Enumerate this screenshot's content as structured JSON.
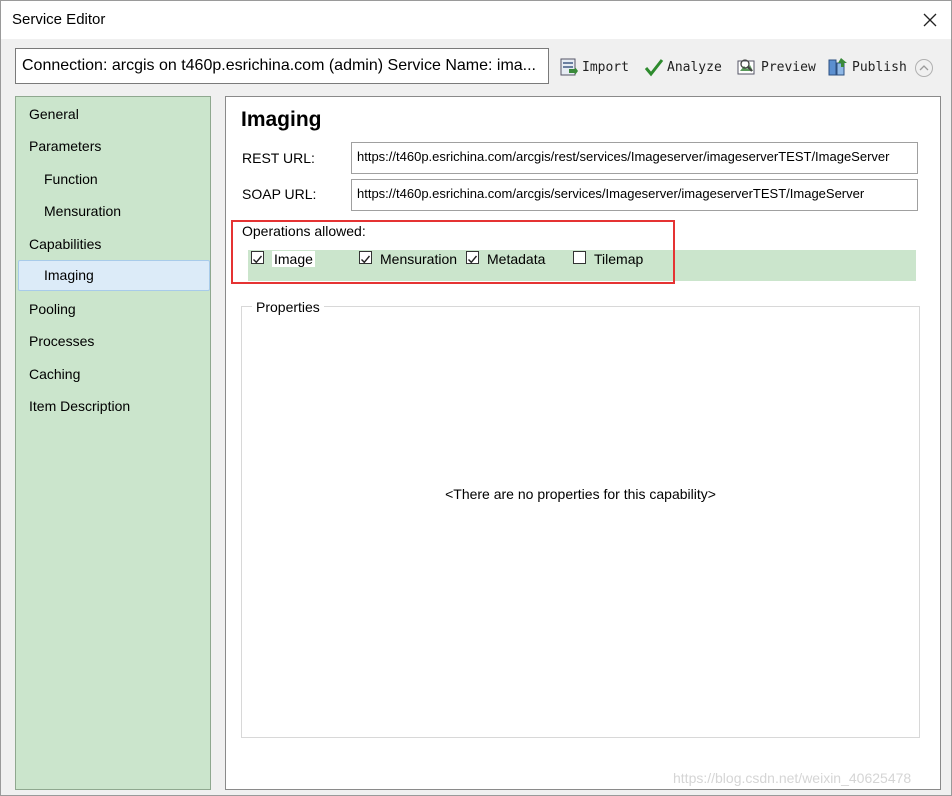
{
  "window": {
    "title": "Service Editor"
  },
  "connection": {
    "text": "Connection: arcgis on t460p.esrichina.com (admin)    Service Name: ima..."
  },
  "toolbar": {
    "import_label": "Import",
    "analyze_label": "Analyze",
    "preview_label": "Preview",
    "publish_label": "Publish"
  },
  "sidebar": {
    "items": [
      {
        "label": "General"
      },
      {
        "label": "Parameters"
      },
      {
        "label": "Function"
      },
      {
        "label": "Mensuration"
      },
      {
        "label": "Capabilities"
      },
      {
        "label": "Imaging"
      },
      {
        "label": "Pooling"
      },
      {
        "label": "Processes"
      },
      {
        "label": "Caching"
      },
      {
        "label": "Item Description"
      }
    ],
    "selected": "Imaging"
  },
  "main": {
    "heading": "Imaging",
    "rest_label": "REST URL:",
    "rest_url": "https://t460p.esrichina.com/arcgis/rest/services/Imageserver/imageserverTEST/ImageServer",
    "soap_label": "SOAP URL:",
    "soap_url": "https://t460p.esrichina.com/arcgis/services/Imageserver/imageserverTEST/ImageServer",
    "ops_label": "Operations allowed:",
    "operations": [
      {
        "label": "Image",
        "checked": true
      },
      {
        "label": "Mensuration",
        "checked": true
      },
      {
        "label": "Metadata",
        "checked": true
      },
      {
        "label": "Tilemap",
        "checked": false
      }
    ],
    "properties_label": "Properties",
    "no_properties": "<There are no properties for this capability>"
  },
  "watermark": "https://blog.csdn.net/weixin_40625478",
  "colors": {
    "sidebar_bg": "#cbe5cc",
    "selection": "#dcebf8",
    "highlight_border": "#e53333",
    "check_green": "#2e8b2e"
  }
}
